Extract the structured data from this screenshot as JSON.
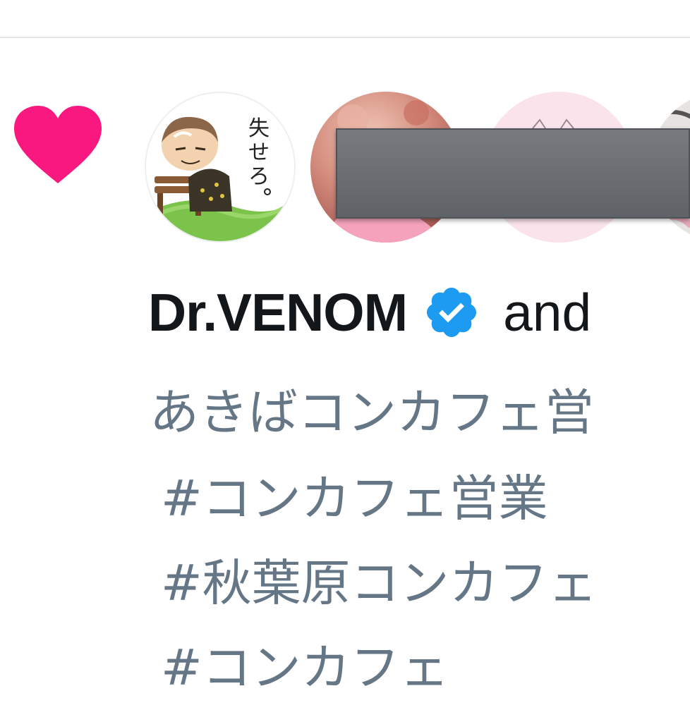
{
  "colors": {
    "heart": "#f91880",
    "name": "#14171a",
    "description": "#657786",
    "verified": "#1d9bf0",
    "divider": "#e3e7ea",
    "redaction": "#6b6f73"
  },
  "icons": {
    "like": "heart-icon",
    "verified": "verified-badge-icon"
  },
  "liked_by": {
    "avatars": [
      {
        "name": "avatar-dr-venom",
        "caption": "失せろ。"
      },
      {
        "name": "avatar-user-2"
      },
      {
        "name": "avatar-user-3"
      },
      {
        "name": "avatar-user-4"
      }
    ],
    "user_name": "Dr.VENOM",
    "and_text": "and",
    "description_lines": [
      "あきばコンカフェ営",
      "#コンカフェ営業",
      "#秋葉原コンカフェ",
      "#コンカフェ"
    ]
  }
}
